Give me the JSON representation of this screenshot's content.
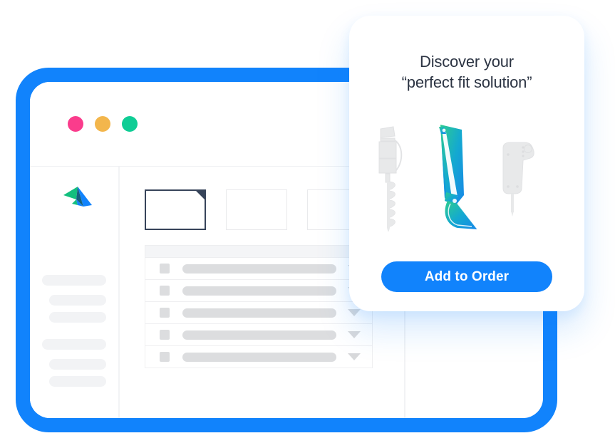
{
  "window": {
    "frame_color": "#1183FC",
    "traffic_lights": [
      {
        "name": "close-dot",
        "color": "#FA3C8C"
      },
      {
        "name": "minimize-dot",
        "color": "#F3B64C"
      },
      {
        "name": "maximize-dot",
        "color": "#0FCD95"
      }
    ],
    "logo_icon": "paper-plane-icon"
  },
  "sidebar": {
    "placeholder_items": [
      {
        "width": "wide"
      },
      {
        "width": "narrow"
      },
      {
        "width": "narrow"
      },
      {
        "width": "wide"
      },
      {
        "width": "narrow"
      },
      {
        "width": "narrow"
      }
    ]
  },
  "thumbnails": [
    {
      "name": "thumbnail-card-1",
      "selected": true
    },
    {
      "name": "thumbnail-card-2",
      "selected": false
    },
    {
      "name": "thumbnail-card-3",
      "selected": false
    }
  ],
  "table": {
    "rows": [
      {
        "checkbox_icon": "checkbox-icon",
        "caret_icon": "chevron-down-icon"
      },
      {
        "checkbox_icon": "checkbox-icon",
        "caret_icon": "chevron-down-icon"
      },
      {
        "checkbox_icon": "checkbox-icon",
        "caret_icon": "chevron-down-icon"
      },
      {
        "checkbox_icon": "checkbox-icon",
        "caret_icon": "chevron-down-icon"
      },
      {
        "checkbox_icon": "checkbox-icon",
        "caret_icon": "chevron-down-icon"
      }
    ]
  },
  "promo": {
    "title_line1": "Discover your",
    "title_line2": "“perfect fit solution”",
    "cta_label": "Add to Order",
    "cta_color": "#1183FC",
    "products": [
      {
        "name": "auger-attachment",
        "highlighted": false,
        "color": "#E8E9EA"
      },
      {
        "name": "excavator-bucket-attachment",
        "highlighted": true,
        "gradient_start": "#2ECC8F",
        "gradient_end": "#1787E8"
      },
      {
        "name": "hydraulic-breaker-attachment",
        "highlighted": false,
        "color": "#E8E9EA"
      }
    ]
  }
}
